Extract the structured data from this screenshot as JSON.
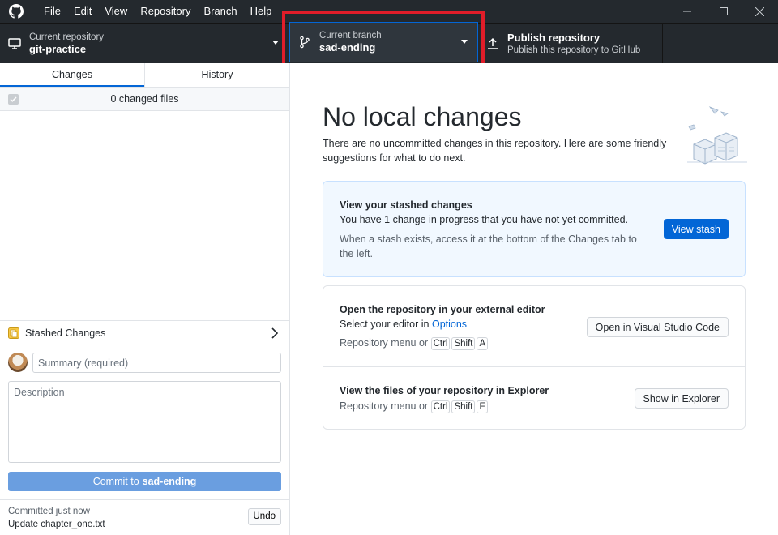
{
  "menu": {
    "items": [
      {
        "label": "File"
      },
      {
        "label": "Edit"
      },
      {
        "label": "View"
      },
      {
        "label": "Repository"
      },
      {
        "label": "Branch"
      },
      {
        "label": "Help"
      }
    ]
  },
  "toolbar": {
    "repo_label": "Current repository",
    "repo_value": "git-practice",
    "branch_label": "Current branch",
    "branch_value": "sad-ending",
    "publish_label": "Publish repository",
    "publish_sub": "Publish this repository to GitHub"
  },
  "tabs": [
    {
      "label": "Changes",
      "active": true
    },
    {
      "label": "History",
      "active": false
    }
  ],
  "changes": {
    "count_label": "0 changed files"
  },
  "stash": {
    "label": "Stashed Changes"
  },
  "commit": {
    "summary_placeholder": "Summary (required)",
    "description_placeholder": "Description",
    "button_prefix": "Commit to",
    "button_branch": "sad-ending"
  },
  "last_commit": {
    "time": "Committed just now",
    "message": "Update chapter_one.txt",
    "undo_label": "Undo"
  },
  "main": {
    "title": "No local changes",
    "description": "There are no uncommitted changes in this repository. Here are some friendly suggestions for what to do next.",
    "stash_card": {
      "title": "View your stashed changes",
      "text": "You have 1 change in progress that you have not yet committed.",
      "hint": "When a stash exists, access it at the bottom of the Changes tab to the left.",
      "button": "View stash"
    },
    "editor_card": {
      "title": "Open the repository in your external editor",
      "text_prefix": "Select your editor in",
      "text_link": "Options",
      "shortcut_prefix": "Repository menu or",
      "keys": [
        "Ctrl",
        "Shift",
        "A"
      ],
      "button": "Open in Visual Studio Code"
    },
    "explorer_card": {
      "title": "View the files of your repository in Explorer",
      "shortcut_prefix": "Repository menu or",
      "keys": [
        "Ctrl",
        "Shift",
        "F"
      ],
      "button": "Show in Explorer"
    }
  },
  "colors": {
    "toolbar_bg": "#24292e",
    "accent": "#0366d6",
    "highlight": "#e11d29",
    "commit_button": "#6a9ee0"
  }
}
